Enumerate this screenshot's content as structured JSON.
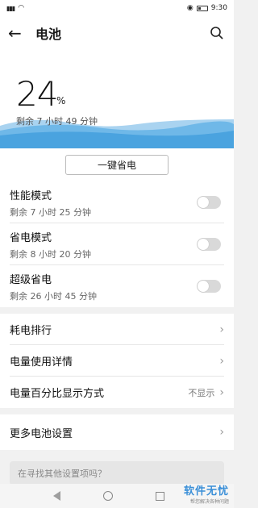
{
  "status": {
    "time": "9:30",
    "signal": "4G",
    "wifi": "wifi"
  },
  "header": {
    "title": "电池"
  },
  "battery": {
    "percent": "24",
    "unit": "%",
    "remaining": "剩余 7 小时 49 分钟",
    "level": 0.24,
    "wave_color": "#4aa3df"
  },
  "actions": {
    "one_click": "一键省电"
  },
  "modes": [
    {
      "name": "性能模式",
      "sub": "剩余 7 小时 25 分钟",
      "on": false
    },
    {
      "name": "省电模式",
      "sub": "剩余 8 小时 20 分钟",
      "on": false
    },
    {
      "name": "超级省电",
      "sub": "剩余 26 小时 45 分钟",
      "on": false
    }
  ],
  "list": [
    {
      "label": "耗电排行",
      "value": ""
    },
    {
      "label": "电量使用详情",
      "value": ""
    },
    {
      "label": "电量百分比显示方式",
      "value": "不显示"
    }
  ],
  "more": {
    "label": "更多电池设置"
  },
  "search": {
    "placeholder": "在寻找其他设置项吗？"
  },
  "watermark": {
    "line1": "软件无忧",
    "line2": "帮您解决各种问题"
  }
}
